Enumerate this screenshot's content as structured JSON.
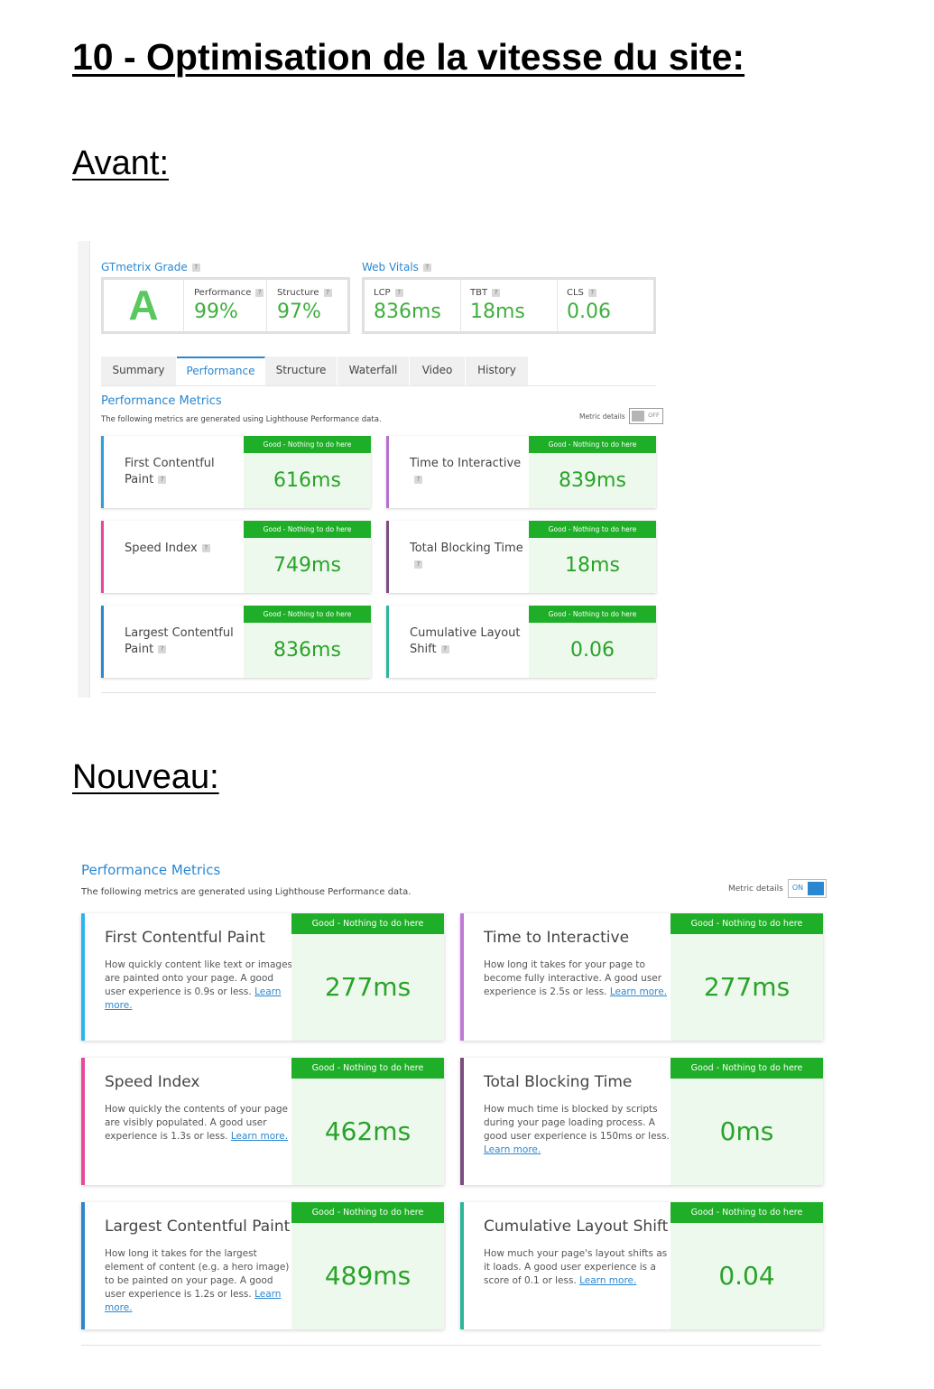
{
  "document": {
    "title": "10 - Optimisation de la vitesse du site:",
    "avant_heading": "Avant:",
    "nouveau_heading": "Nouveau:"
  },
  "avant": {
    "grade_label": "GTmetrix Grade",
    "vitals_label": "Web Vitals",
    "grade": "A",
    "grade_metrics": [
      {
        "label": "Performance",
        "value": "99%"
      },
      {
        "label": "Structure",
        "value": "97%"
      }
    ],
    "web_vitals": [
      {
        "label": "LCP",
        "value": "836ms"
      },
      {
        "label": "TBT",
        "value": "18ms"
      },
      {
        "label": "CLS",
        "value": "0.06"
      }
    ],
    "tabs": [
      "Summary",
      "Performance",
      "Structure",
      "Waterfall",
      "Video",
      "History"
    ],
    "active_tab": "Performance",
    "section_title": "Performance Metrics",
    "section_desc": "The following metrics are generated using Lighthouse Performance data.",
    "metric_details_label": "Metric details",
    "toggle_state": "OFF",
    "cards": [
      {
        "name": "First Contentful Paint",
        "status": "Good - Nothing to do here",
        "value": "616ms",
        "color": "#2b9fe0"
      },
      {
        "name": "Time to Interactive",
        "status": "Good - Nothing to do here",
        "value": "839ms",
        "color": "#b66fd0"
      },
      {
        "name": "Speed Index",
        "status": "Good - Nothing to do here",
        "value": "749ms",
        "color": "#e8479a"
      },
      {
        "name": "Total Blocking Time",
        "status": "Good - Nothing to do here",
        "value": "18ms",
        "color": "#7a4f80"
      },
      {
        "name": "Largest Contentful Paint",
        "status": "Good - Nothing to do here",
        "value": "836ms",
        "color": "#2b87d0"
      },
      {
        "name": "Cumulative Layout Shift",
        "status": "Good - Nothing to do here",
        "value": "0.06",
        "color": "#2db79a"
      }
    ]
  },
  "nouveau": {
    "section_title": "Performance Metrics",
    "section_desc": "The following metrics are generated using Lighthouse Performance data.",
    "metric_details_label": "Metric details",
    "toggle_state": "ON",
    "learn_more": "Learn more.",
    "cards": [
      {
        "name": "First Contentful Paint",
        "desc": "How quickly content like text or images are painted onto your page. A good user experience is 0.9s or less.",
        "status": "Good - Nothing to do here",
        "value": "277ms",
        "color": "#2bb5ef"
      },
      {
        "name": "Time to Interactive",
        "desc": "How long it takes for your page to become fully interactive. A good user experience is 2.5s or less.",
        "status": "Good - Nothing to do here",
        "value": "277ms",
        "color": "#c07ad6"
      },
      {
        "name": "Speed Index",
        "desc": "How quickly the contents of your page are visibly populated. A good user experience is 1.3s or less.",
        "status": "Good - Nothing to do here",
        "value": "462ms",
        "color": "#e8479a"
      },
      {
        "name": "Total Blocking Time",
        "desc": "How much time is blocked by scripts during your page loading process. A good user experience is 150ms or less.",
        "status": "Good - Nothing to do here",
        "value": "0ms",
        "color": "#7a4f80"
      },
      {
        "name": "Largest Contentful Paint",
        "desc": "How long it takes for the largest element of content (e.g. a hero image) to be painted on your page. A good user experience is 1.2s or less.",
        "status": "Good - Nothing to do here",
        "value": "489ms",
        "color": "#2b87d0"
      },
      {
        "name": "Cumulative Layout Shift",
        "desc": "How much your page's layout shifts as it loads. A good user experience is a score of 0.1 or less.",
        "status": "Good - Nothing to do here",
        "value": "0.04",
        "color": "#2db79a"
      }
    ]
  }
}
